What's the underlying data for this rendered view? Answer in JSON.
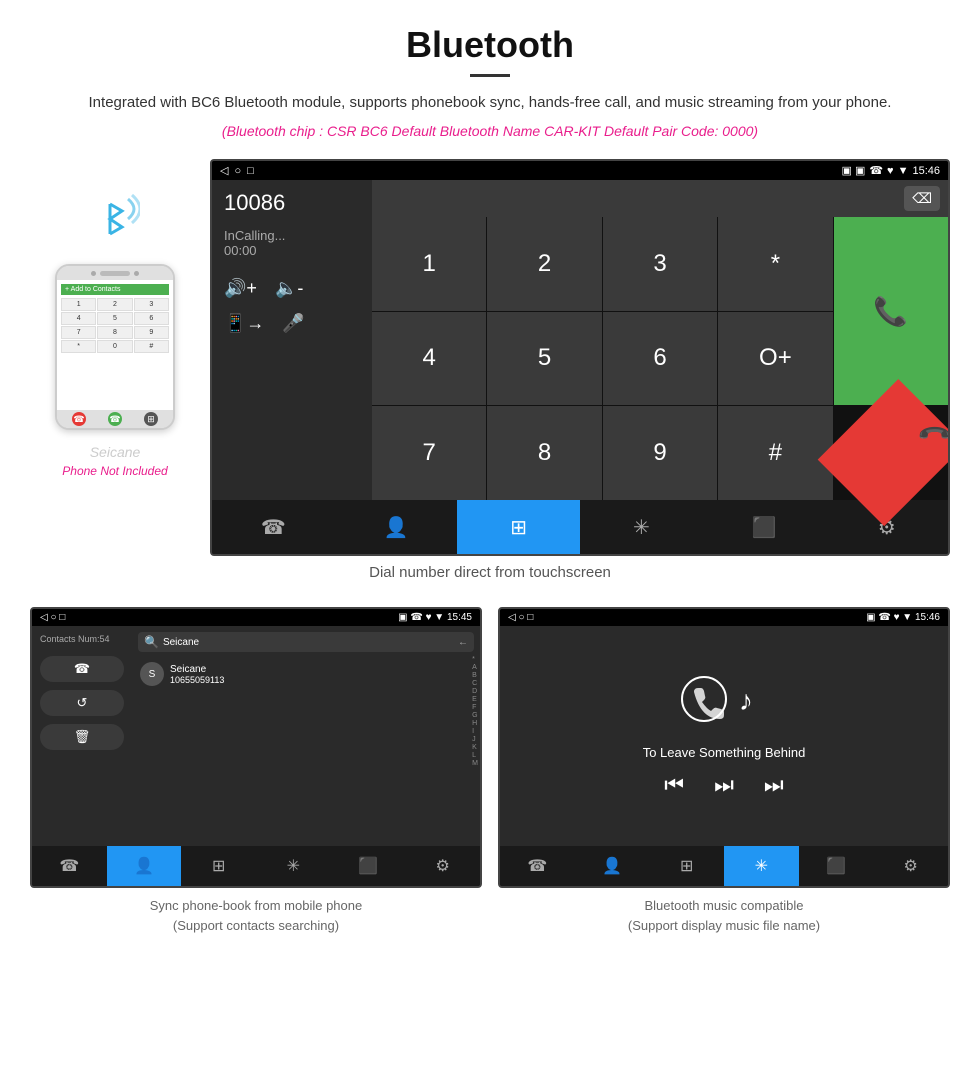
{
  "header": {
    "title": "Bluetooth",
    "description": "Integrated with BC6 Bluetooth module, supports phonebook sync, hands-free call, and music streaming from your phone.",
    "specs": "(Bluetooth chip : CSR BC6    Default Bluetooth Name CAR-KIT    Default Pair Code: 0000)"
  },
  "phone_side": {
    "bluetooth_symbol": "&#x29BF;",
    "not_included_label": "Phone Not Included",
    "seicane_label": "Seicane"
  },
  "car_screen": {
    "status_bar": {
      "left": "◁  ○  □",
      "right": "☎ ♥ ▼ 15:46"
    },
    "phone_number": "10086",
    "calling_label": "InCalling...",
    "timer": "00:00",
    "keys": [
      "1",
      "2",
      "3",
      "*",
      "4",
      "5",
      "6",
      "O+",
      "7",
      "8",
      "9",
      "#"
    ],
    "green_btn": "📞",
    "red_btn": "📞",
    "nav_items": [
      "☎",
      "👤",
      "⊞",
      "✳",
      "⬛",
      "⚙"
    ]
  },
  "dial_label": "Dial number direct from touchscreen",
  "contacts_screen": {
    "contacts_num": "Contacts Num:54",
    "search_placeholder": "Seicane",
    "contact_name": "Seicane",
    "contact_phone": "10655059113",
    "nav_items": [
      "☎",
      "👤",
      "⊞",
      "✳",
      "⬛",
      "⚙"
    ],
    "alpha": [
      "*",
      "A",
      "B",
      "C",
      "D",
      "E",
      "F",
      "G",
      "H",
      "I",
      "J",
      "K",
      "L",
      "M"
    ]
  },
  "contacts_label": {
    "main": "Sync phone-book from mobile phone",
    "sub": "(Support contacts searching)"
  },
  "music_screen": {
    "song_title": "To Leave Something Behind",
    "nav_items": [
      "☎",
      "👤",
      "⊞",
      "✳",
      "⬛",
      "⚙"
    ]
  },
  "music_label": {
    "main": "Bluetooth music compatible",
    "sub": "(Support display music file name)"
  }
}
